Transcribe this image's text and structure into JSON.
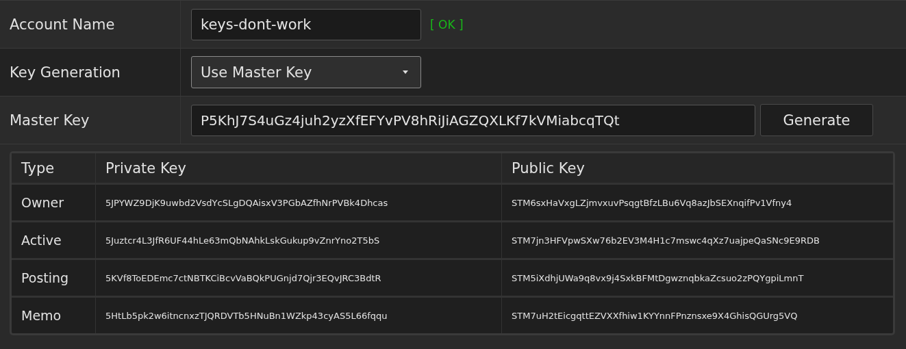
{
  "form": [
    {
      "kind": "text",
      "label": "Account Name",
      "value": "keys-dont-work",
      "status": "[ OK ]"
    },
    {
      "kind": "select",
      "label": "Key Generation",
      "value": "Use Master Key"
    },
    {
      "kind": "generate",
      "label": "Master Key",
      "value": "P5KhJ7S4uGz4juh2yzXfEFYvPV8hRiJiAGZQXLKf7kVMiabcqTQt",
      "button": "Generate"
    }
  ],
  "table": {
    "columns": [
      "Type",
      "Private Key",
      "Public Key"
    ],
    "rows": [
      [
        "Owner",
        "5JPYWZ9DjK9uwbd2VsdYcSLgDQAisxV3PGbAZfhNrPVBk4Dhcas",
        "STM6sxHaVxgLZjmvxuvPsqgtBfzLBu6Vq8azJbSEXnqifPv1Vfny4"
      ],
      [
        "Active",
        "5Juztcr4L3JfR6UF44hLe63mQbNAhkLskGukup9vZnrYno2T5bS",
        "STM7jn3HFVpwSXw76b2EV3M4H1c7mswc4qXz7uajpeQaSNc9E9RDB"
      ],
      [
        "Posting",
        "5KVf8ToEDEmc7ctNBTKCiBcvVaBQkPUGnjd7Qjr3EQvJRC3BdtR",
        "STM5iXdhjUWa9q8vx9j4SxkBFMtDgwznqbkaZcsuo2zPQYgpiLmnT"
      ],
      [
        "Memo",
        "5HtLb5pk2w6itncnxzTJQRDVTb5HNuBn1WZkp43cyAS5L66fqqu",
        "STM7uH2tEicgqttEZVXXfhiw1KYYnnFPnznsxe9X4GhisQGUrg5VQ"
      ]
    ]
  }
}
